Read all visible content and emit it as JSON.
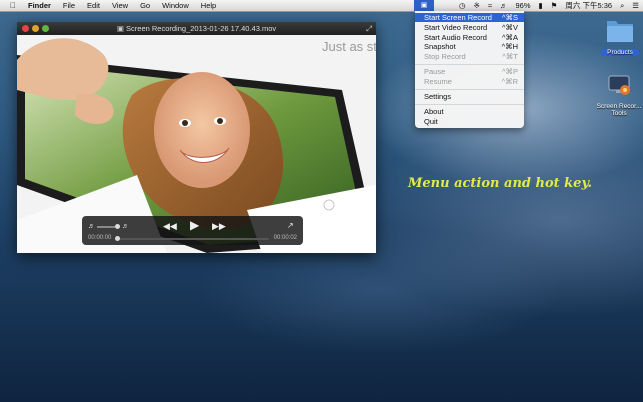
{
  "menubar": {
    "app_name": "Finder",
    "menus": [
      "File",
      "Edit",
      "View",
      "Go",
      "Window",
      "Help"
    ],
    "battery": "96%",
    "clock": "周六 下午5:36"
  },
  "video_window": {
    "title": "Screen Recording_2013-01-26 17.40.43.mov",
    "tagline": "Just as st",
    "time_elapsed": "00:00:00",
    "time_remaining": "00:00:02"
  },
  "status_menu": {
    "items": [
      {
        "label": "Start Screen Record",
        "key": "^⌘S",
        "state": "highlighted"
      },
      {
        "label": "Start Video Record",
        "key": "^⌘V",
        "state": "enabled"
      },
      {
        "label": "Start Audio Record",
        "key": "^⌘A",
        "state": "enabled"
      },
      {
        "label": "Snapshot",
        "key": "^⌘H",
        "state": "enabled"
      },
      {
        "label": "Stop Record",
        "key": "^⌘T",
        "state": "disabled"
      },
      {
        "label": "Pause",
        "key": "^⌘P",
        "state": "disabled"
      },
      {
        "label": "Resume",
        "key": "^⌘R",
        "state": "disabled"
      },
      {
        "label": "Settings",
        "key": "",
        "state": "enabled"
      },
      {
        "label": "About",
        "key": "",
        "state": "enabled"
      },
      {
        "label": "Quit",
        "key": "",
        "state": "enabled"
      }
    ]
  },
  "desktop_icons": {
    "products": "Products",
    "screen_recorder_tools": "Screen Recor... Tools"
  },
  "annotation": "Menu action and hot key.",
  "colors": {
    "highlight": "#2f62d3",
    "annotation": "#e3e94a",
    "folder": "#6aa6e0"
  }
}
